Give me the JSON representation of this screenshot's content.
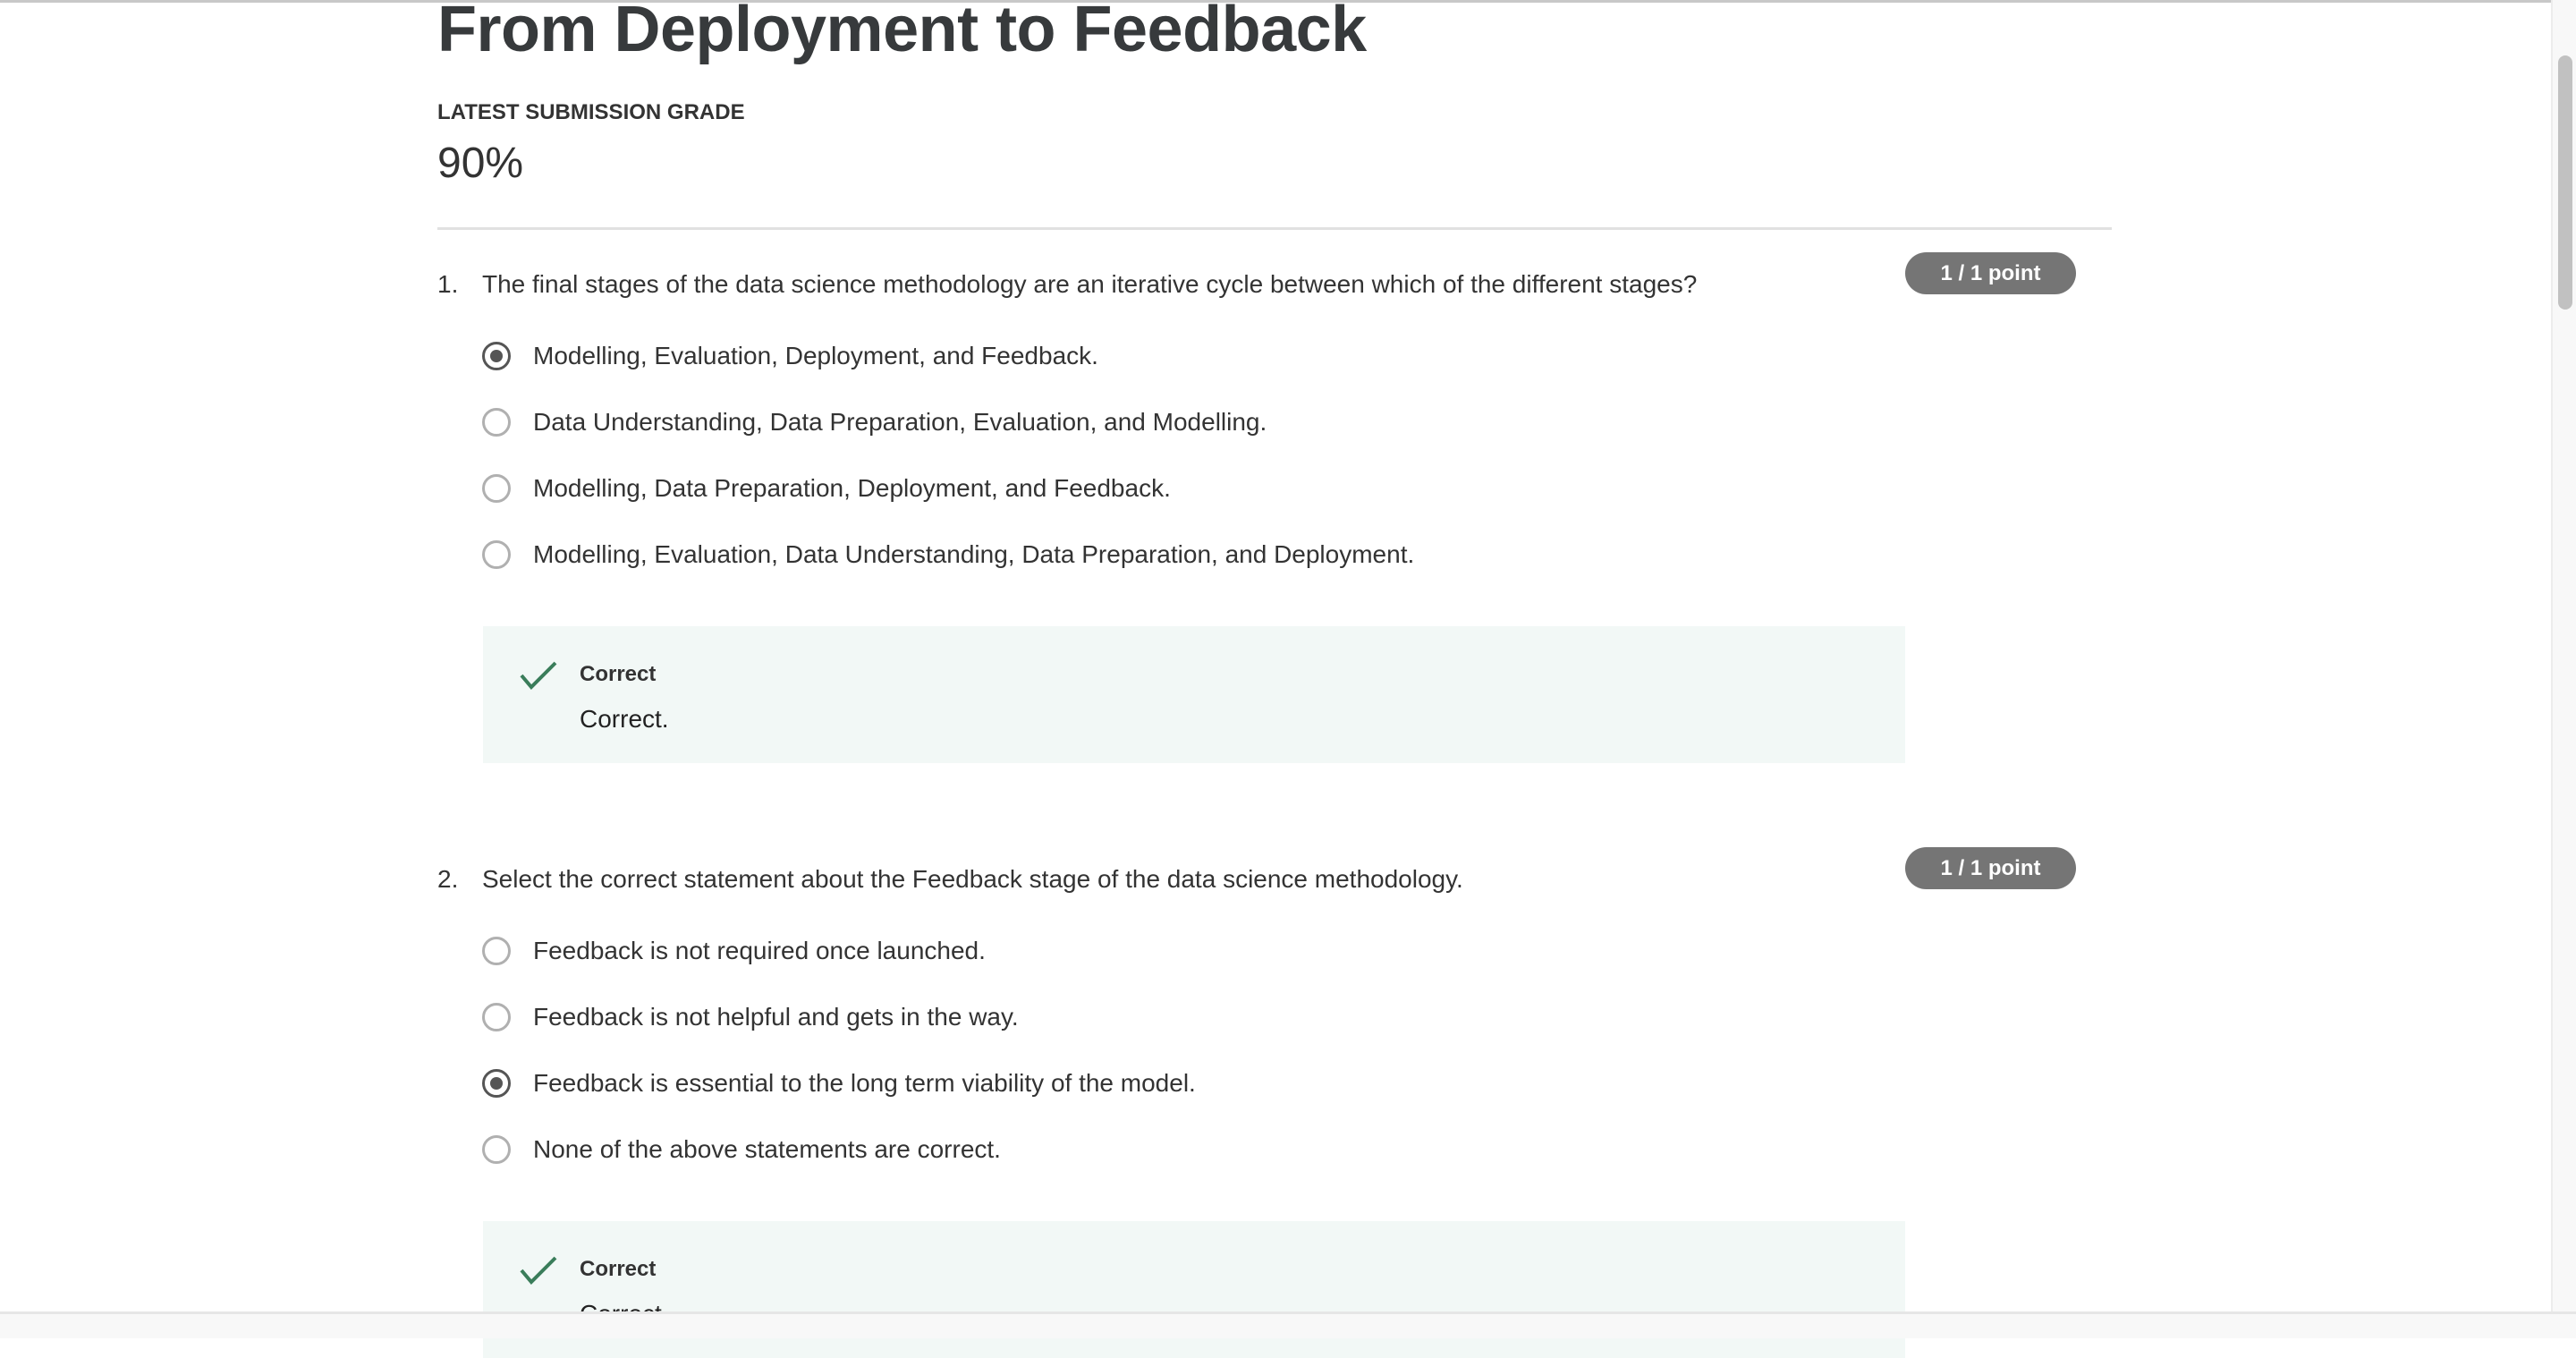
{
  "page": {
    "title": "From Deployment to Feedback",
    "grade_label": "LATEST SUBMISSION GRADE",
    "grade_value": "90%"
  },
  "questions": [
    {
      "number": "1.",
      "text": "The final stages of the data science methodology are an iterative cycle between which of the different stages?",
      "points": "1 / 1 point",
      "options": [
        {
          "label": "Modelling, Evaluation, Deployment, and Feedback.",
          "selected": true
        },
        {
          "label": "Data Understanding, Data Preparation, Evaluation, and Modelling.",
          "selected": false
        },
        {
          "label": "Modelling, Data Preparation, Deployment, and Feedback.",
          "selected": false
        },
        {
          "label": "Modelling, Evaluation, Data Understanding, Data Preparation, and Deployment.",
          "selected": false
        }
      ],
      "feedback": {
        "status": "Correct",
        "text": "Correct.",
        "icon": "check-icon",
        "color": "#3a7d5a"
      }
    },
    {
      "number": "2.",
      "text": "Select the correct statement about the Feedback stage of the data science methodology.",
      "points": "1 / 1 point",
      "options": [
        {
          "label": "Feedback is not required once launched.",
          "selected": false
        },
        {
          "label": "Feedback is not helpful and gets in the way.",
          "selected": false
        },
        {
          "label": "Feedback is essential to the long term viability of the model.",
          "selected": true
        },
        {
          "label": "None of the above statements are correct.",
          "selected": false
        }
      ],
      "feedback": {
        "status": "Correct",
        "text": "Correct.",
        "icon": "check-icon",
        "color": "#3a7d5a"
      }
    }
  ]
}
